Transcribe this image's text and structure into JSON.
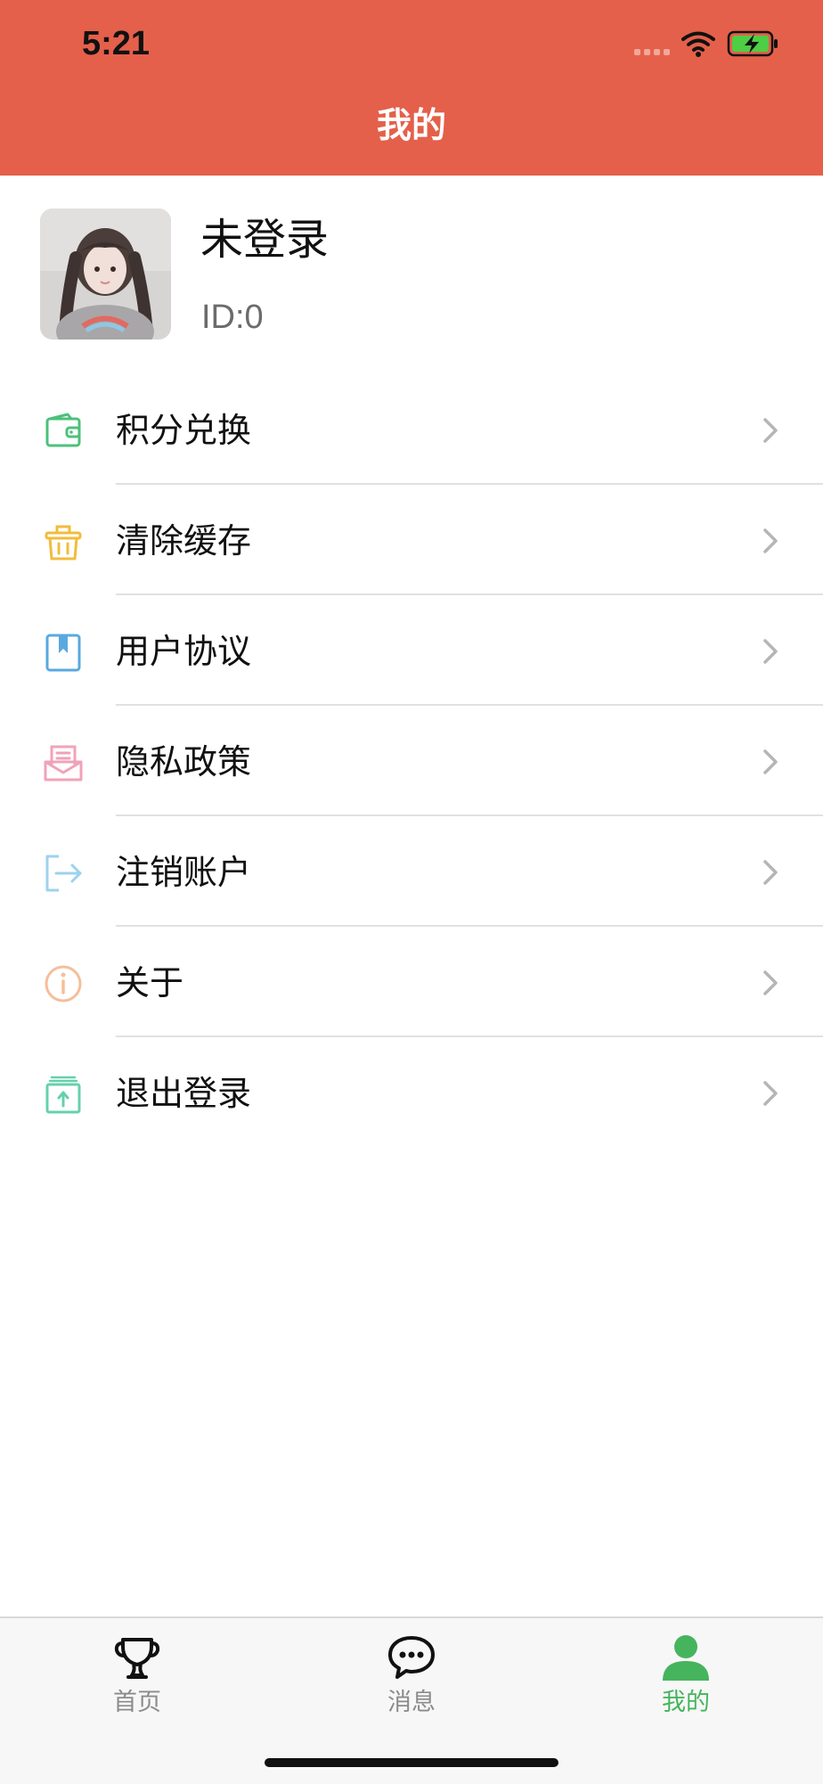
{
  "status_bar": {
    "time": "5:21",
    "icons": [
      "cellular-signal-icon",
      "wifi-icon",
      "battery-charging-icon"
    ]
  },
  "header": {
    "title": "我的",
    "background_color": "#E4604A"
  },
  "profile": {
    "name": "未登录",
    "id_text": "ID:0",
    "avatar_icon": "user-photo-avatar"
  },
  "menu": {
    "items": [
      {
        "label": "积分兑换",
        "icon": "wallet-icon",
        "icon_color": "#4CC17A"
      },
      {
        "label": "清除缓存",
        "icon": "trash-basket-icon",
        "icon_color": "#F1BC3B"
      },
      {
        "label": "用户协议",
        "icon": "bookmark-book-icon",
        "icon_color": "#59A9DF"
      },
      {
        "label": "隐私政策",
        "icon": "mail-tray-icon",
        "icon_color": "#F2A2B8"
      },
      {
        "label": "注销账户",
        "icon": "logout-arrow-icon",
        "icon_color": "#9CD3EE"
      },
      {
        "label": "关于",
        "icon": "info-circle-icon",
        "icon_color": "#F5BE9B"
      },
      {
        "label": "退出登录",
        "icon": "upload-tray-icon",
        "icon_color": "#66D0AC"
      }
    ]
  },
  "tabbar": {
    "tabs": [
      {
        "label": "首页",
        "icon": "trophy-icon",
        "active": false
      },
      {
        "label": "消息",
        "icon": "chat-bubble-icon",
        "active": false
      },
      {
        "label": "我的",
        "icon": "person-icon",
        "active": true
      }
    ],
    "active_color": "#46B45D",
    "inactive_color": "#8B8B8B"
  }
}
